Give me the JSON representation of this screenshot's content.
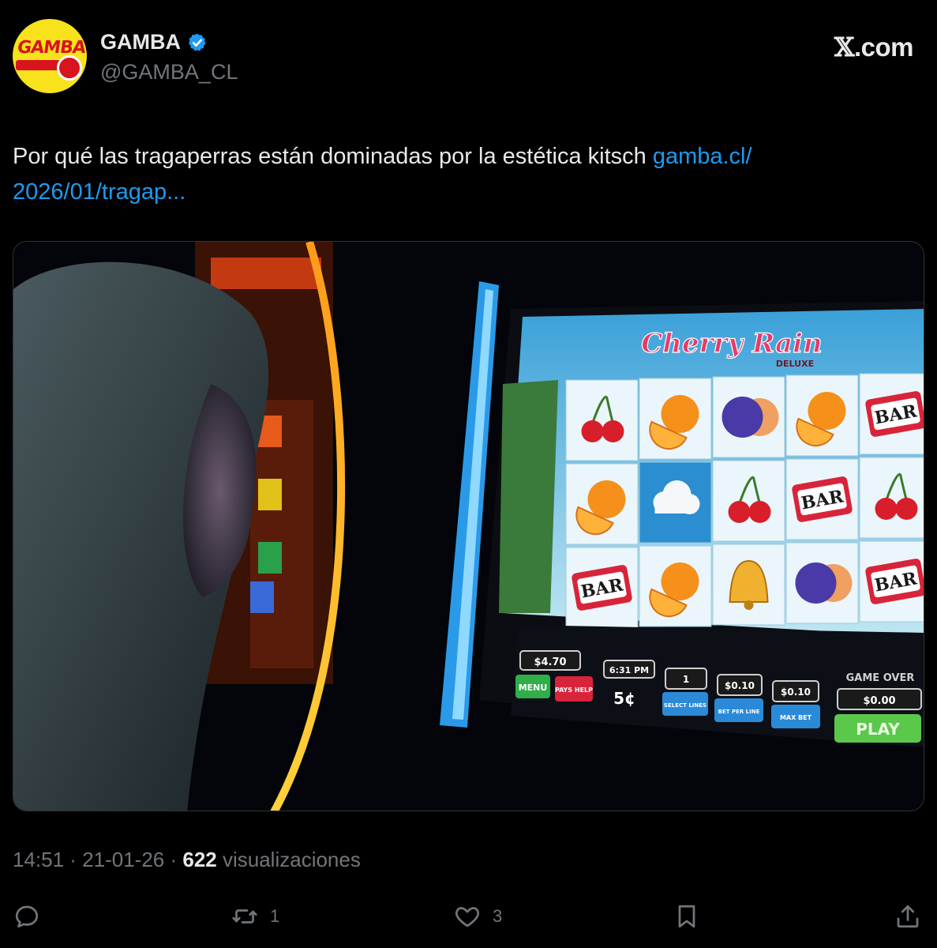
{
  "author": {
    "display_name": "GAMBA",
    "handle": "@GAMBA_CL",
    "avatar_text": "GAMBA",
    "verified": true
  },
  "brand": {
    "site": ".com",
    "icon": "x-logo-icon"
  },
  "tweet": {
    "text": "Por qué las tragaperras están dominadas por la estética kitsch ",
    "link_line1": "gamba.cl/",
    "link_line2": "2026/01/tragap..."
  },
  "media": {
    "game_title": "Cherry Rain",
    "game_subtitle": "DELUXE",
    "reels": [
      [
        "cherry",
        "orange",
        "plum",
        "orange",
        "bar"
      ],
      [
        "orange",
        "cloud",
        "cherry",
        "bar",
        "cherry"
      ],
      [
        "bar",
        "orange",
        "bell",
        "plum",
        "bar"
      ]
    ],
    "panel": {
      "credit": "$4.70",
      "menu": "MENU",
      "pays_help": "PAYS HELP",
      "time": "6:31 PM",
      "denomination": "5¢",
      "lines": "1",
      "lines_label": "SELECT LINES",
      "bet": "$0.10",
      "bet_label": "BET PER LINE",
      "total_bet": "$0.10",
      "total_bet_label": "MAX BET",
      "game_over": "GAME OVER",
      "win": "$0.00",
      "play": "PLAY",
      "bar_label": "BAR"
    }
  },
  "meta": {
    "time": "14:51",
    "separator": " · ",
    "date": "21-01-26",
    "views_count": "622",
    "views_label": " visualizaciones"
  },
  "actions": {
    "reply_count": "",
    "retweet_count": "1",
    "like_count": "3"
  },
  "colors": {
    "link": "#1d9bf0",
    "muted": "#71767b",
    "verified": "#1d9bf0"
  }
}
